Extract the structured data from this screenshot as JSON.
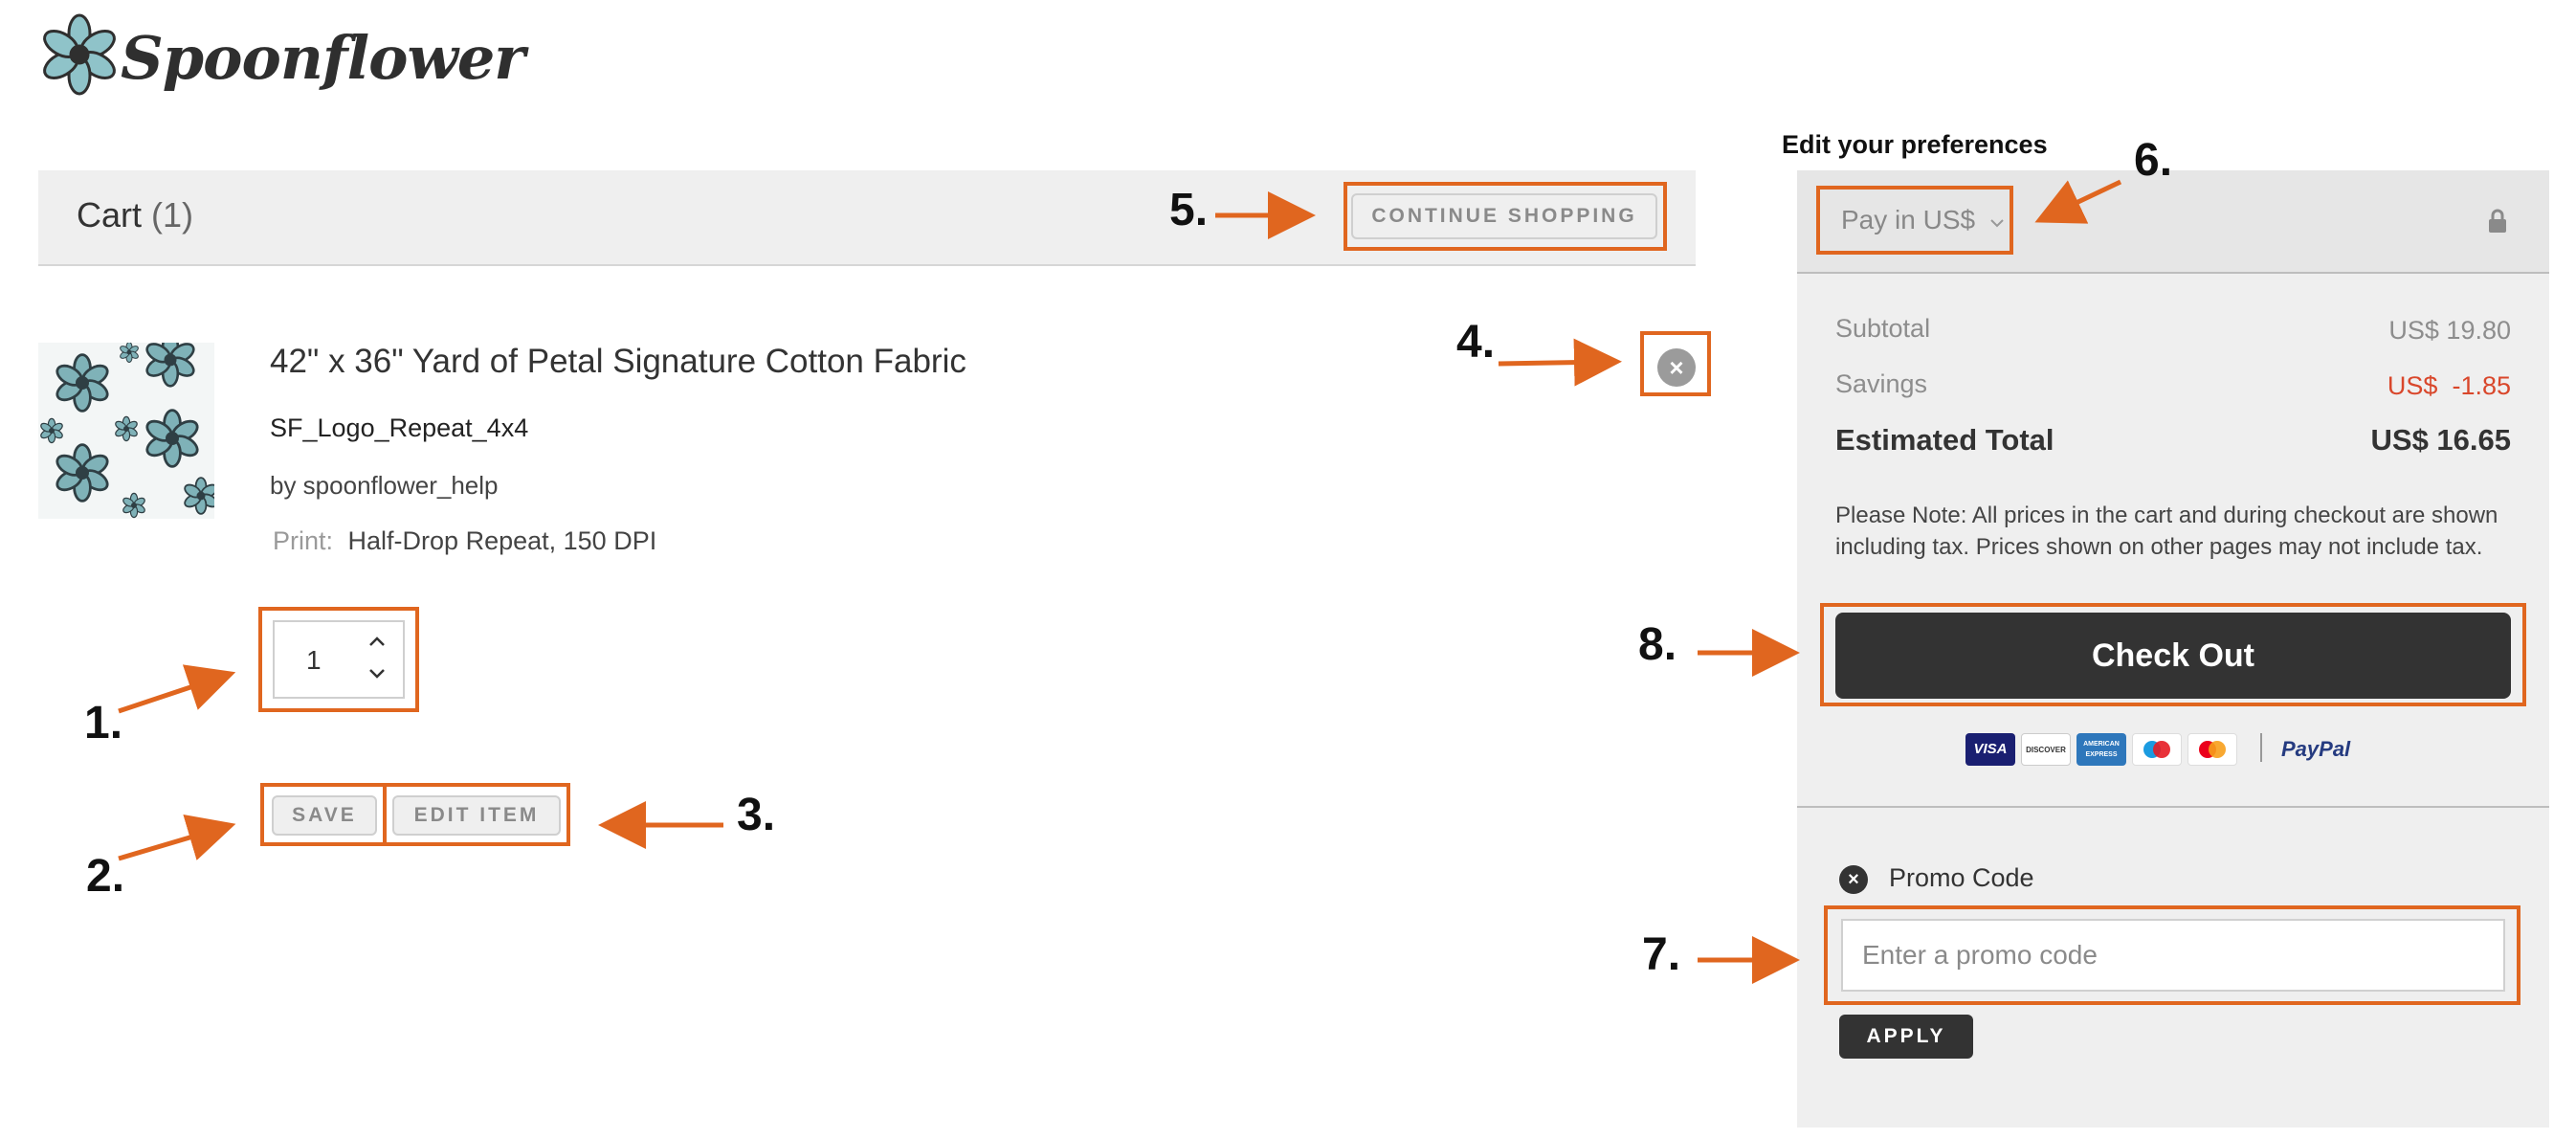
{
  "brand": {
    "name": "Spoonflower"
  },
  "cart": {
    "title": "Cart",
    "count": "(1)",
    "continue_label": "CONTINUE SHOPPING"
  },
  "item": {
    "title": "42\" x 36\" Yard of Petal Signature Cotton Fabric",
    "design": "SF_Logo_Repeat_4x4",
    "by": "by spoonflower_help",
    "print_label": "Print:",
    "print_value": "Half-Drop Repeat, 150 DPI",
    "quantity": "1",
    "save_label": "SAVE",
    "edit_label": "EDIT ITEM"
  },
  "preferences": {
    "title": "Edit your preferences",
    "currency_label": "Pay in US$"
  },
  "summary": {
    "subtotal_label": "Subtotal",
    "subtotal_value": "US$ 19.80",
    "savings_label": "Savings",
    "savings_value": "US$  -1.85",
    "total_label": "Estimated Total",
    "total_value": "US$ 16.65",
    "note": "Please Note: All prices in the cart and during checkout are shown including tax. Prices shown on other pages may not include tax.",
    "checkout_label": "Check Out",
    "payment_methods": [
      "VISA",
      "DISCOVER",
      "AMERICAN EXPRESS",
      "Maestro",
      "Mastercard",
      "PayPal"
    ]
  },
  "promo": {
    "label": "Promo Code",
    "placeholder": "Enter a promo code",
    "apply_label": "APPLY"
  },
  "annotations": [
    "1.",
    "2.",
    "3.",
    "4.",
    "5.",
    "6.",
    "7.",
    "8."
  ],
  "colors": {
    "accent": "#e0661f",
    "savings": "#d9472b",
    "dark": "#333333",
    "panel": "#efefef"
  }
}
